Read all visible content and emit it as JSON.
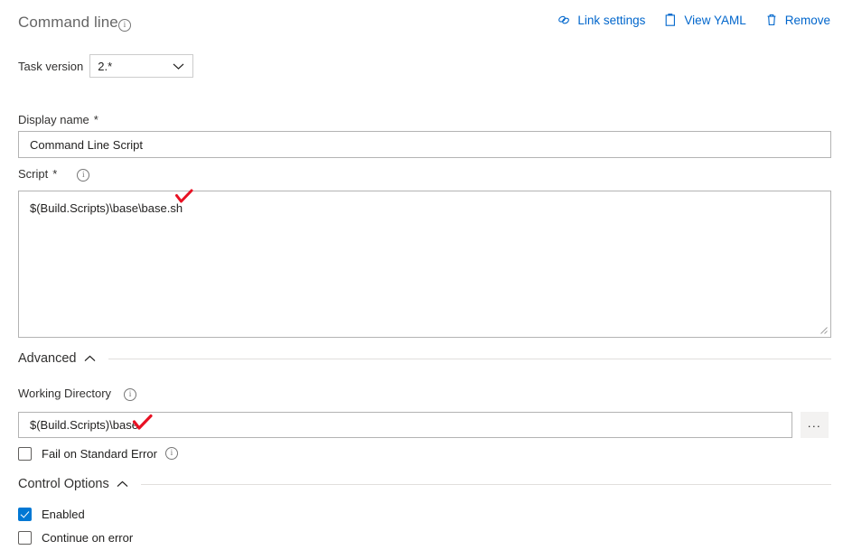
{
  "header": {
    "task_title": "Command line",
    "info_icon": "info-icon",
    "actions": [
      {
        "label": "Link settings",
        "icon": "link-chain-icon"
      },
      {
        "label": "View YAML",
        "icon": "clipboard-icon"
      },
      {
        "label": "Remove",
        "icon": "trash-icon"
      }
    ]
  },
  "task_version": {
    "label": "Task version",
    "value": "2.*",
    "chevron_icon": "chevron-down-icon"
  },
  "display_name": {
    "label": "Display name",
    "required_marker": "*",
    "value": "Command Line Script"
  },
  "script": {
    "label": "Script",
    "required_marker": "*",
    "info_icon": "info-icon",
    "value": "$(Build.Scripts)\\base\\base.sh",
    "resize_grip_icon": "resize-grip-icon"
  },
  "advanced": {
    "title": "Advanced",
    "chevron_icon": "chevron-up-icon",
    "working_directory": {
      "label": "Working Directory",
      "info_icon": "info-icon",
      "value": "$(Build.Scripts)\\base",
      "browse_label": "...",
      "browse_icon": "ellipsis-icon"
    },
    "fail_on_standard_error": {
      "label": "Fail on Standard Error",
      "checked": false,
      "info_icon": "info-icon"
    }
  },
  "control_options": {
    "title": "Control Options",
    "chevron_icon": "chevron-up-icon",
    "enabled": {
      "label": "Enabled",
      "checked": true
    },
    "continue_on_error": {
      "label": "Continue on error",
      "checked": false
    }
  },
  "annotations": [
    {
      "type": "red-checkmark",
      "near": "script-value"
    },
    {
      "type": "red-checkmark",
      "near": "working-directory-value"
    }
  ],
  "colors": {
    "accent_blue": "#0078d4",
    "link_blue": "#0066cc",
    "annotation_red": "#e81123",
    "title_gray": "#666666",
    "text_primary": "#201f1e",
    "border_gray": "#b3b3b3",
    "rule_gray": "#e1dfdd"
  }
}
